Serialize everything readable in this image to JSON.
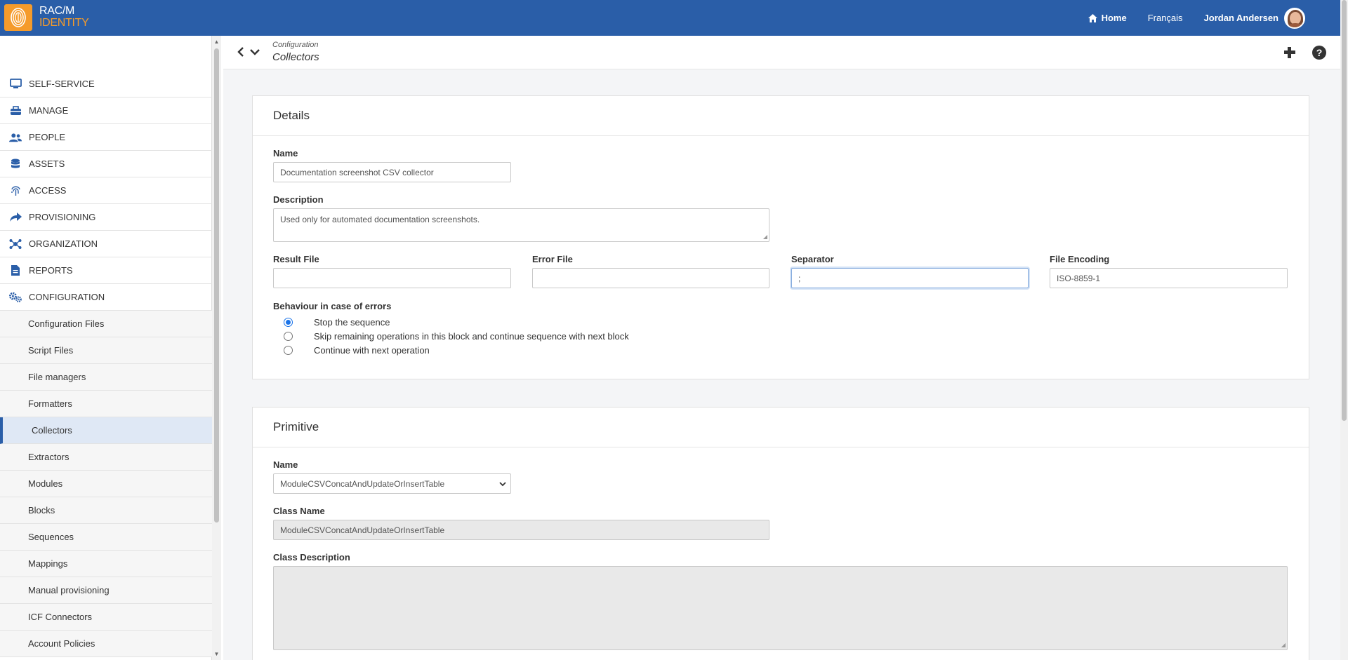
{
  "header": {
    "logo_line1": "RAC/M",
    "logo_line2": "IDENTITY",
    "home_label": "Home",
    "lang_label": "Français",
    "user_name": "Jordan Andersen"
  },
  "sidebar": {
    "items": [
      {
        "label": "SELF-SERVICE",
        "icon": "monitor-icon"
      },
      {
        "label": "MANAGE",
        "icon": "toolbox-icon"
      },
      {
        "label": "PEOPLE",
        "icon": "users-icon"
      },
      {
        "label": "ASSETS",
        "icon": "database-icon"
      },
      {
        "label": "ACCESS",
        "icon": "fingerprint-icon"
      },
      {
        "label": "PROVISIONING",
        "icon": "share-arrow-icon"
      },
      {
        "label": "ORGANIZATION",
        "icon": "network-icon"
      },
      {
        "label": "REPORTS",
        "icon": "file-icon"
      },
      {
        "label": "CONFIGURATION",
        "icon": "gears-icon"
      }
    ],
    "subitems": [
      "Configuration Files",
      "Script Files",
      "File managers",
      "Formatters",
      "Collectors",
      "Extractors",
      "Modules",
      "Blocks",
      "Sequences",
      "Mappings",
      "Manual provisioning",
      "ICF Connectors",
      "Account Policies"
    ],
    "active_subitem": "Collectors"
  },
  "breadcrumb": {
    "parent": "Configuration",
    "current": "Collectors"
  },
  "details": {
    "title": "Details",
    "name_label": "Name",
    "name_value": "Documentation screenshot CSV collector",
    "description_label": "Description",
    "description_value": "Used only for automated documentation screenshots.",
    "result_file_label": "Result File",
    "result_file_value": "",
    "error_file_label": "Error File",
    "error_file_value": "",
    "separator_label": "Separator",
    "separator_value": ";",
    "encoding_label": "File Encoding",
    "encoding_value": "ISO-8859-1",
    "behaviour_label": "Behaviour in case of errors",
    "behaviour_options": [
      "Stop the sequence",
      "Skip remaining operations in this block and continue sequence with next block",
      "Continue with next operation"
    ],
    "behaviour_selected": "Stop the sequence"
  },
  "primitive": {
    "title": "Primitive",
    "name_label": "Name",
    "name_value": "ModuleCSVConcatAndUpdateOrInsertTable",
    "class_name_label": "Class Name",
    "class_name_value": "ModuleCSVConcatAndUpdateOrInsertTable",
    "class_description_label": "Class Description",
    "class_description_value": ""
  },
  "colors": {
    "brand": "#2a5ea8",
    "accent": "#f59b2b",
    "active_bg": "#dfe8f5"
  }
}
